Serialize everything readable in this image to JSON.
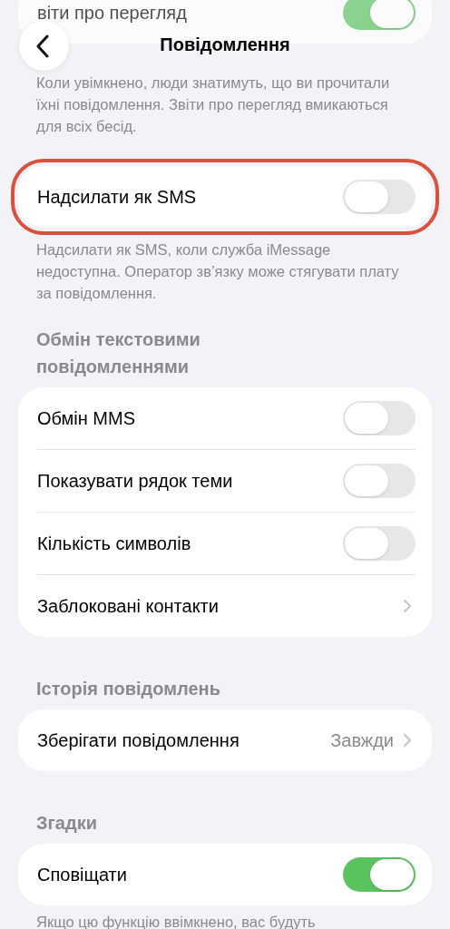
{
  "nav": {
    "title": "Повідомлення"
  },
  "sections": [
    {
      "rows": [
        {
          "kind": "toggle",
          "label": "віти про перегляд",
          "on": true
        }
      ],
      "footer": "Коли увімкнено, люди знатимуть, що ви прочитали їхні повідомлення. Звіти про перегляд вмикаються для всіх бесід."
    },
    {
      "highlighted": true,
      "rows": [
        {
          "kind": "toggle",
          "label": "Надсилати як SMS",
          "on": false
        }
      ],
      "footer": "Надсилати як SMS, коли служба iMessage недоступна. Оператор зв’язку може стягувати плату за повідомлення."
    },
    {
      "header": "Обмін текстовими повідомленнями",
      "rows": [
        {
          "kind": "toggle",
          "label": "Обмін MMS",
          "on": false
        },
        {
          "kind": "toggle",
          "label": "Показувати рядок теми",
          "on": false
        },
        {
          "kind": "toggle",
          "label": "Кількість символів",
          "on": false
        },
        {
          "kind": "link",
          "label": "Заблоковані контакти"
        }
      ]
    },
    {
      "header": "Історія повідомлень",
      "rows": [
        {
          "kind": "value",
          "label": "Зберігати повідомлення",
          "value": "Завжди"
        }
      ]
    },
    {
      "header": "Згадки",
      "rows": [
        {
          "kind": "toggle",
          "label": "Сповіщати",
          "on": true
        }
      ],
      "footer": "Якщо цю функцію ввімкнено, вас будуть"
    }
  ]
}
